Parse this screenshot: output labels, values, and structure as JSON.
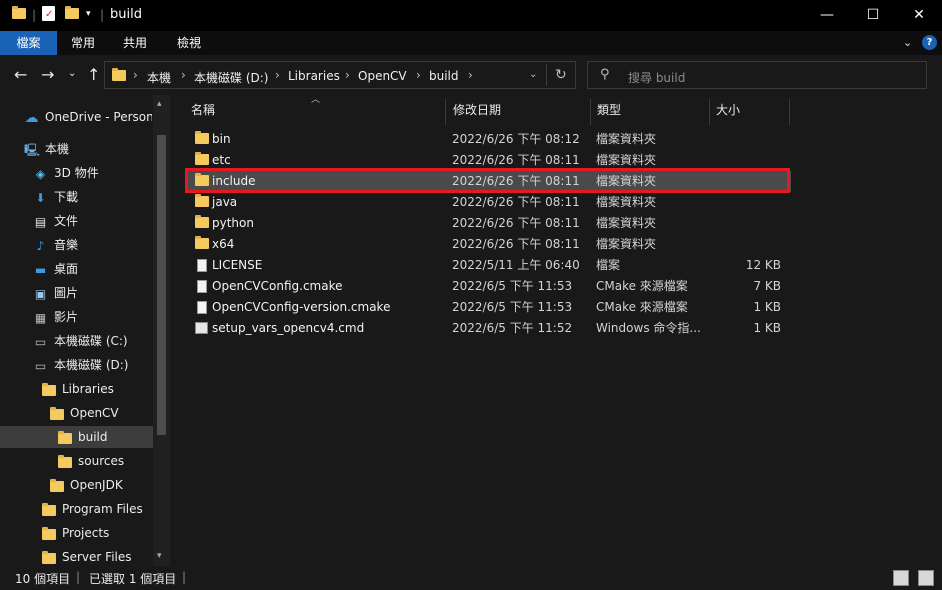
{
  "window": {
    "title": "build",
    "controls": {
      "minimize": "—",
      "maximize": "☐",
      "close": "✕"
    }
  },
  "ribbon": {
    "tabs": [
      {
        "label": "檔案",
        "active": true
      },
      {
        "label": "常用"
      },
      {
        "label": "共用"
      },
      {
        "label": "檢視"
      }
    ]
  },
  "breadcrumb": [
    "本機",
    "本機磁碟 (D:)",
    "Libraries",
    "OpenCV",
    "build"
  ],
  "search": {
    "placeholder": "搜尋 build"
  },
  "nav": {
    "items": [
      {
        "label": "OneDrive - Persona",
        "icon": "cloud-icon"
      },
      {
        "label": "本機",
        "icon": "computer-icon"
      },
      {
        "label": "3D 物件",
        "icon": "cube-icon"
      },
      {
        "label": "下載",
        "icon": "download-icon"
      },
      {
        "label": "文件",
        "icon": "document-icon"
      },
      {
        "label": "音樂",
        "icon": "music-icon"
      },
      {
        "label": "桌面",
        "icon": "desktop-icon"
      },
      {
        "label": "圖片",
        "icon": "picture-icon"
      },
      {
        "label": "影片",
        "icon": "video-icon"
      },
      {
        "label": "本機磁碟 (C:)",
        "icon": "drive-icon"
      },
      {
        "label": "本機磁碟 (D:)",
        "icon": "drive-icon"
      },
      {
        "label": "Libraries",
        "icon": "folder-icon"
      },
      {
        "label": "OpenCV",
        "icon": "folder-icon"
      },
      {
        "label": "build",
        "icon": "folder-icon",
        "selected": true
      },
      {
        "label": "sources",
        "icon": "folder-icon"
      },
      {
        "label": "OpenJDK",
        "icon": "folder-icon"
      },
      {
        "label": "Program Files",
        "icon": "folder-icon"
      },
      {
        "label": "Projects",
        "icon": "folder-icon"
      },
      {
        "label": "Server Files",
        "icon": "folder-icon"
      }
    ]
  },
  "columns": {
    "name": "名稱",
    "date": "修改日期",
    "type": "類型",
    "size": "大小"
  },
  "files": [
    {
      "name": "bin",
      "date": "2022/6/26 下午 08:12",
      "type": "檔案資料夾",
      "size": "",
      "icon": "folder-icon"
    },
    {
      "name": "etc",
      "date": "2022/6/26 下午 08:11",
      "type": "檔案資料夾",
      "size": "",
      "icon": "folder-icon"
    },
    {
      "name": "include",
      "date": "2022/6/26 下午 08:11",
      "type": "檔案資料夾",
      "size": "",
      "icon": "folder-icon",
      "selected": true
    },
    {
      "name": "java",
      "date": "2022/6/26 下午 08:11",
      "type": "檔案資料夾",
      "size": "",
      "icon": "folder-icon"
    },
    {
      "name": "python",
      "date": "2022/6/26 下午 08:11",
      "type": "檔案資料夾",
      "size": "",
      "icon": "folder-icon"
    },
    {
      "name": "x64",
      "date": "2022/6/26 下午 08:11",
      "type": "檔案資料夾",
      "size": "",
      "icon": "folder-icon"
    },
    {
      "name": "LICENSE",
      "date": "2022/5/11 上午 06:40",
      "type": "檔案",
      "size": "12 KB",
      "icon": "file-icon"
    },
    {
      "name": "OpenCVConfig.cmake",
      "date": "2022/6/5 下午 11:53",
      "type": "CMake 來源檔案",
      "size": "7 KB",
      "icon": "file-icon"
    },
    {
      "name": "OpenCVConfig-version.cmake",
      "date": "2022/6/5 下午 11:53",
      "type": "CMake 來源檔案",
      "size": "1 KB",
      "icon": "file-icon"
    },
    {
      "name": "setup_vars_opencv4.cmd",
      "date": "2022/6/5 下午 11:52",
      "type": "Windows 命令指...",
      "size": "1 KB",
      "icon": "cmd-file-icon"
    }
  ],
  "status": {
    "count": "10 個項目",
    "selected": "已選取 1 個項目"
  },
  "colors": {
    "accent": "#1a62b6",
    "highlight": "#e5191f",
    "folder": "#f4c95d"
  }
}
